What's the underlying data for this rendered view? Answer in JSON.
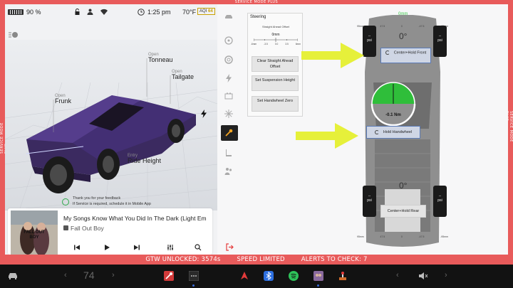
{
  "service": {
    "label": "SERVICE MODE PLUS"
  },
  "status": {
    "battery_pct": "90 %",
    "time": "1:25 pm",
    "temp": "70°F",
    "aqi_label": "AQI",
    "aqi_value": "64"
  },
  "car": {
    "tonneau": {
      "state": "Open",
      "name": "Tonneau"
    },
    "tailgate": {
      "state": "Open",
      "name": "Tailgate"
    },
    "frunk": {
      "state": "Open",
      "name": "Frunk"
    },
    "ride": {
      "state": "Entry",
      "name": "Ride Height"
    }
  },
  "feedback": {
    "line1": "Thank you for your feedback",
    "line2": "If Service is required, schedule it in Mobile App"
  },
  "media": {
    "title": "My Songs Know What You Did In The Dark (Light Em",
    "artist": "Fall Out Boy",
    "album_text": "FALL OUT BOY"
  },
  "steering": {
    "title": "Steering",
    "offset_label": "Straight Ahead Offset",
    "offset_value": "0mm",
    "ticks": [
      "-6mm",
      "-3.5",
      "0.0",
      "3.5",
      "6mm"
    ],
    "btn_clear": "Clear Straight Ahead Offset",
    "btn_susp": "Set Suspension Height",
    "btn_hand": "Set Handwheel Zero"
  },
  "diagram": {
    "top_offset": "0mm",
    "angle_front": "0°",
    "angle_rear": "0°",
    "scale_top": [
      "95mm",
      "47.5",
      "0",
      "-47.5",
      "-95mm"
    ],
    "scale_bottom": [
      "95mm",
      "47.5",
      "0",
      "-47.5",
      "-95mm"
    ],
    "tire_unit": "psi",
    "tire_value": "--",
    "btn_center_front": "Center+Hold Front",
    "btn_hold_hand": "Hold Handwheel",
    "btn_center_rear": "Center+Hold Rear",
    "torque": "-0.1 Nm"
  },
  "alerts": {
    "gtw": "GTW UNLOCKED: 3574s",
    "speed": "SPEED LIMITED",
    "check": "ALERTS TO CHECK: 7"
  },
  "taskbar": {
    "temp_value": "74",
    "chev_left": "‹",
    "chev_right": "›"
  },
  "colors": {
    "gauge_green": "#2fbe3a",
    "arrow_yellow": "#e6f03a",
    "button_blue": "#5a7ab6"
  }
}
